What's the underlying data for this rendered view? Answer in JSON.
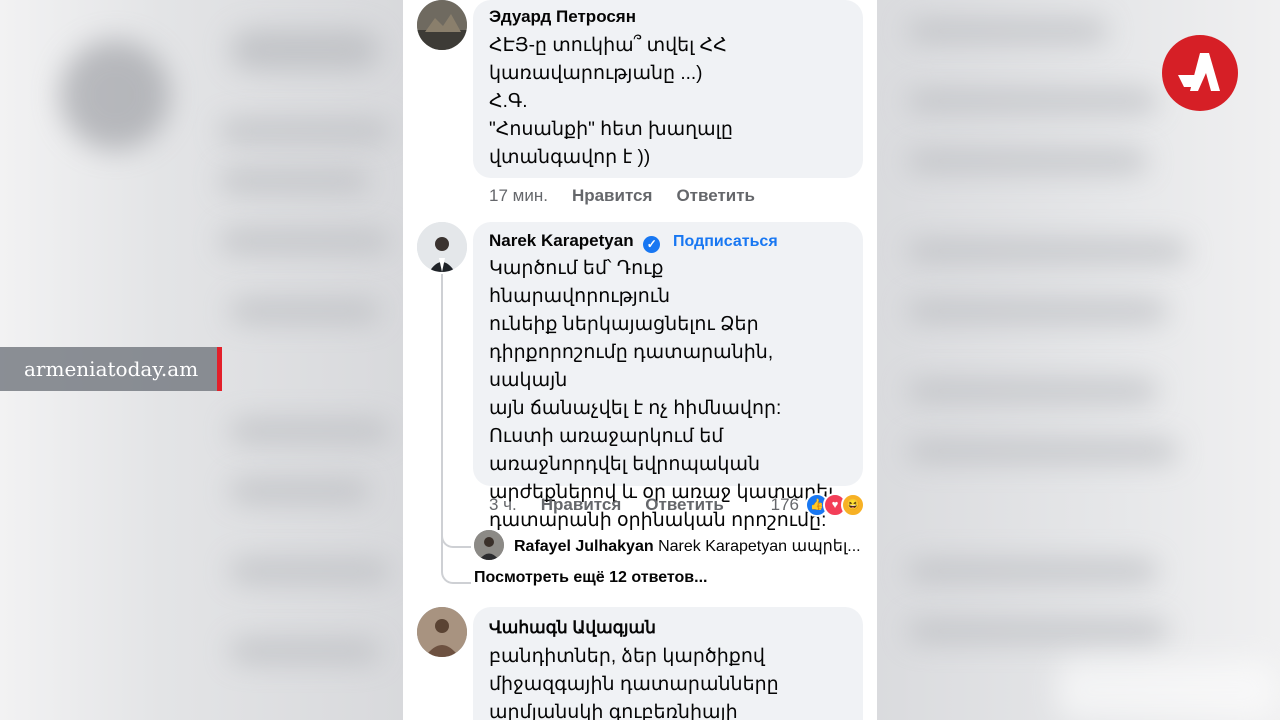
{
  "watermark": {
    "site": "armeniatoday.am"
  },
  "comments": [
    {
      "author": "Эдуард Петросян",
      "text": "ՀԷՅ-ը տուկիա՞ տվել ՀՀ\nկառավարությանը ...)\nՀ.Գ.\n\"Հոսանքի\" հետ խաղալը\nվտանգավոր է ))",
      "time": "17 мин.",
      "like": "Нравится",
      "reply": "Ответить"
    },
    {
      "author": "Narek Karapetyan",
      "follow": "Подписаться",
      "text": "Կարծում եմ՝ Դուք հնարավորություն\nունեիք ներկայացնելու Ձեր\nդիրքորոշումը դատարանին, սակայն\nայն ճանաչվել է ոչ հիմնավոր:\nՈւստի առաջարկում եմ\nառաջնորդվել եվրոպական\nարժեքներով և օր առաջ կատարել\nդատարանի օրինական որոշումը:",
      "time": "3 ч.",
      "like": "Нравится",
      "reply": "Ответить",
      "reaction_count": "176",
      "reply_preview": {
        "author": "Rafayel Julhakyan",
        "text": "Narek Karapetyan ապրել..."
      },
      "more_replies": "Посмотреть ещё 12 ответов..."
    },
    {
      "author": "Վահագն Ավագյան",
      "text": "բանդիտներ, ձեր կարծիքով\nմիջազգային դատարանները\nարմյանսկի գուբեռնիայի"
    }
  ],
  "colors": {
    "accent": "#1877f2",
    "brand": "#d61f26",
    "watermark_bar": "#e3202a"
  },
  "icons": [
    "verified-badge-icon",
    "like-reaction-icon",
    "love-reaction-icon",
    "haha-reaction-icon",
    "armeniatoday-logo-icon"
  ]
}
